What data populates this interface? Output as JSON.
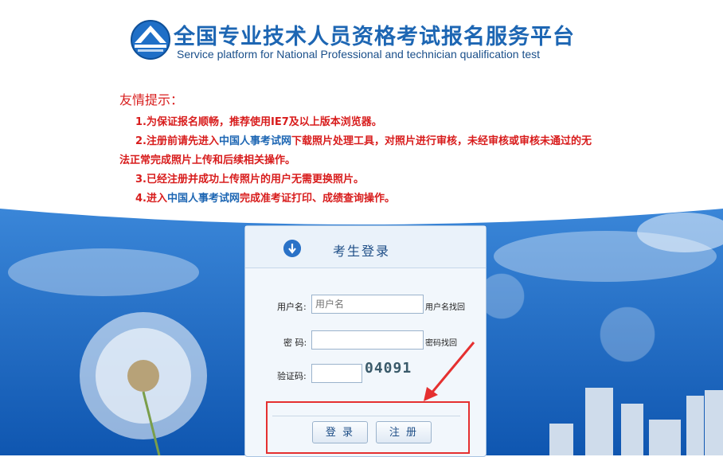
{
  "header": {
    "title_cn": "全国专业技术人员资格考试报名服务平台",
    "title_en": "Service platform for National Professional and technician qualification test"
  },
  "notice": {
    "title": "友情提示：",
    "line1": "1.为保证报名顺畅，推荐使用IE7及以上版本浏览器。",
    "line2_prefix": "2.注册前请先进入",
    "line2_link": "中国人事考试网",
    "line2_suffix": "下载照片处理工具，对照片进行审核，未经审核或审核未通过的无",
    "line2_cont": "法正常完成照片上传和后续相关操作。",
    "line3": "3.已经注册并成功上传照片的用户无需更换照片。",
    "line4_prefix": "4.进入",
    "line4_link": "中国人事考试网",
    "line4_suffix": "完成准考证打印、成绩查询操作。"
  },
  "login": {
    "title": "考生登录",
    "username_label": "用户名:",
    "username_placeholder": "用户名",
    "username_recover": "用户名找回",
    "password_label": "密 码:",
    "password_recover": "密码找回",
    "captcha_label": "验证码:",
    "captcha_text": "04091",
    "login_button": "登 录",
    "register_button": "注 册"
  },
  "colors": {
    "notice_red": "#d81c1c",
    "link_blue": "#1d66b3",
    "highlight_red": "#e53030"
  }
}
